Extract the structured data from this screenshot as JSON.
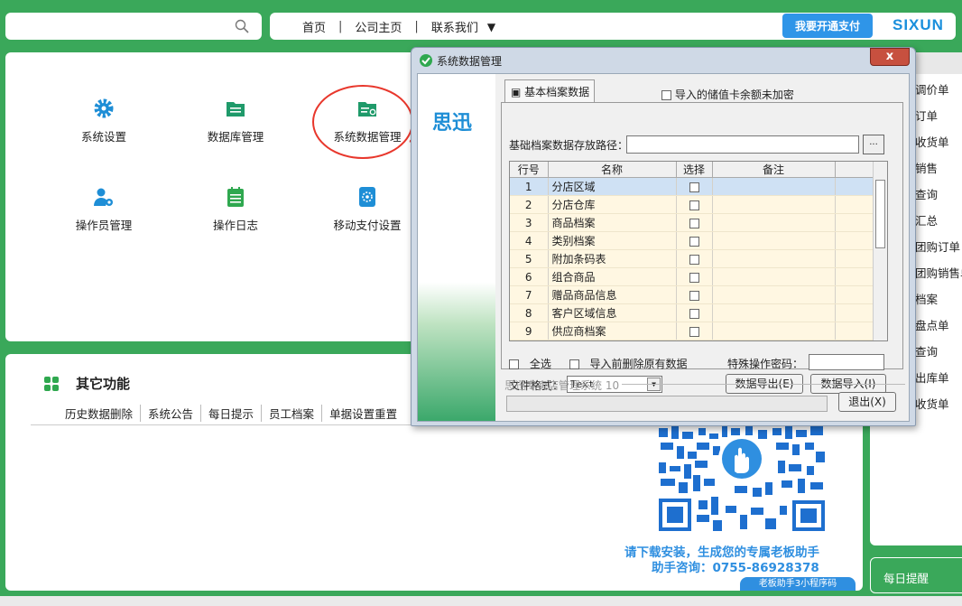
{
  "header": {
    "nav_links": [
      "首页",
      "公司主页",
      "联系我们"
    ],
    "pay_button": "我要开通支付",
    "brand": "SIXUN"
  },
  "tiles": [
    {
      "label": "系统设置",
      "icon": "gear-icon"
    },
    {
      "label": "数据库管理",
      "icon": "folder-icon"
    },
    {
      "label": "系统数据管理",
      "icon": "folder-gear-icon"
    },
    {
      "label": "操作员管理",
      "icon": "user-gear-icon"
    },
    {
      "label": "操作日志",
      "icon": "notebook-icon"
    },
    {
      "label": "移动支付设置",
      "icon": "mobile-pay-icon"
    }
  ],
  "other": {
    "title": "其它功能",
    "items": [
      "历史数据删除",
      "系统公告",
      "每日提示",
      "员工档案",
      "单据设置重置"
    ]
  },
  "promo": {
    "line1": "请下载安装，生成您的专属老板助手",
    "line2": "助手咨询：0755-86928378",
    "badge": "老板助手3小程序码"
  },
  "right_list": [
    "调价单",
    "订单",
    "收货单",
    "销售",
    "查询",
    "汇总",
    "团购订单",
    "团购销售单",
    "档案",
    "盘点单",
    "查询",
    "出库单",
    "收货单"
  ],
  "daily_button": "每日提醒",
  "dialog": {
    "title": "系统数据管理",
    "close": "x",
    "logo": "思迅",
    "tab": "基本档案数据",
    "encrypt_option": "导入的储值卡余额未加密",
    "path_label": "基础档案数据存放路径：",
    "path_value": "",
    "browse": "...",
    "columns": [
      "行号",
      "名称",
      "选择",
      "备注"
    ],
    "rows": [
      {
        "no": "1",
        "name": "分店区域"
      },
      {
        "no": "2",
        "name": "分店仓库"
      },
      {
        "no": "3",
        "name": "商品档案"
      },
      {
        "no": "4",
        "name": "类别档案"
      },
      {
        "no": "5",
        "name": "附加条码表"
      },
      {
        "no": "6",
        "name": "组合商品"
      },
      {
        "no": "7",
        "name": "赠品商品信息"
      },
      {
        "no": "8",
        "name": "客户区域信息"
      },
      {
        "no": "9",
        "name": "供应商档案"
      }
    ],
    "select_all": "全选",
    "delete_before_import": "导入前删除原有数据",
    "password_label": "特殊操作密码：",
    "format_label": "文件格式：",
    "format_value": "Text",
    "export_button": "数据导出(E)",
    "import_button": "数据导入(I)",
    "system_label": "思迅专卖店管理系统 10",
    "exit_button": "退出(X)"
  }
}
